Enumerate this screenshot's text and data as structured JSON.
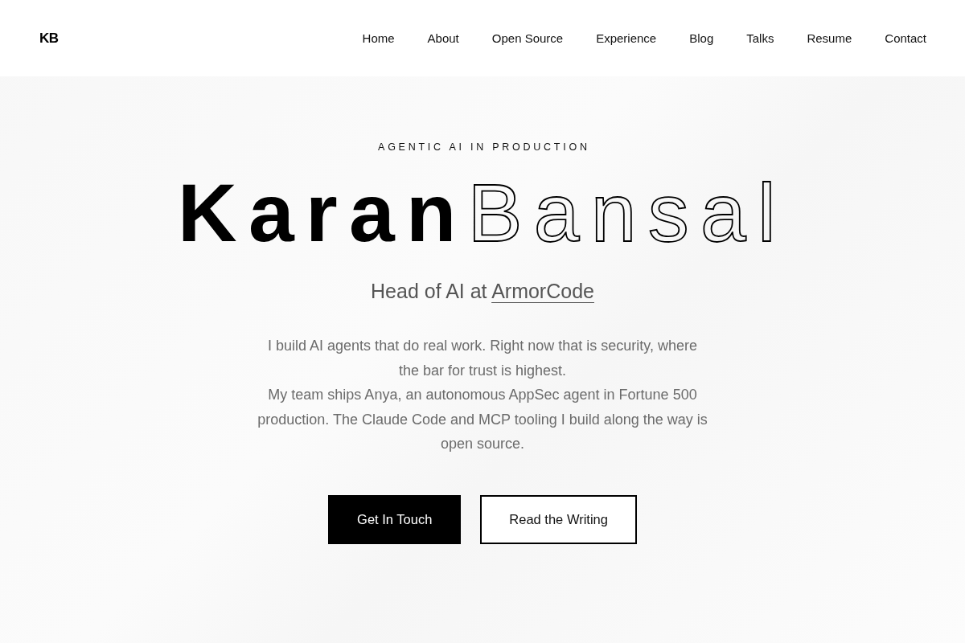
{
  "header": {
    "logo": "KB",
    "nav": [
      {
        "label": "Home"
      },
      {
        "label": "About"
      },
      {
        "label": "Open Source"
      },
      {
        "label": "Experience"
      },
      {
        "label": "Blog"
      },
      {
        "label": "Talks"
      },
      {
        "label": "Resume"
      },
      {
        "label": "Contact"
      }
    ]
  },
  "hero": {
    "eyebrow": "AGENTIC AI IN PRODUCTION",
    "name": {
      "first": "Karan",
      "last": "Bansal"
    },
    "role": {
      "text": "Head of AI at",
      "link": "ArmorCode"
    },
    "paragraphs": [
      "I build AI agents that do real work. Right now that is security, where the bar for trust is highest.",
      "My team ships Anya, an autonomous AppSec agent in Fortune 500 production. The Claude Code and MCP tooling I build along the way is open source."
    ],
    "buttons": [
      {
        "label": "Get In Touch",
        "kind": "primary"
      },
      {
        "label": "Read the Writing",
        "kind": "secondary"
      }
    ]
  }
}
